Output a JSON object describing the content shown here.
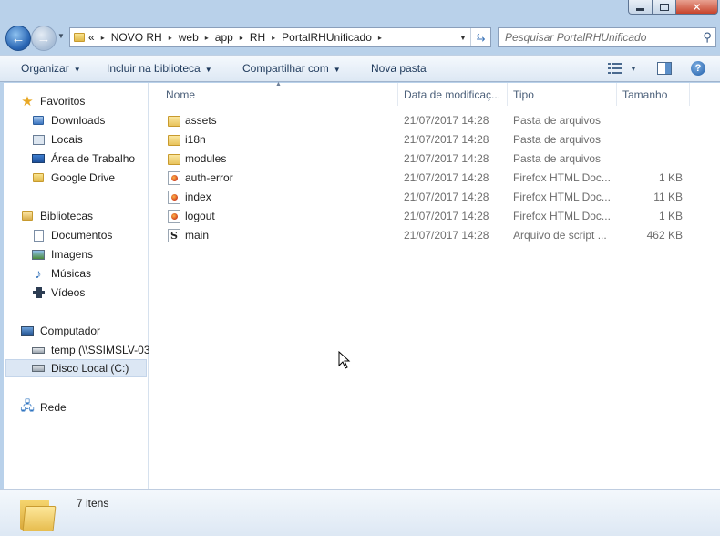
{
  "address_bar": {
    "overflow": "«",
    "crumbs": [
      "NOVO RH",
      "web",
      "app",
      "RH",
      "PortalRHUnificado"
    ]
  },
  "search": {
    "placeholder": "Pesquisar PortalRHUnificado"
  },
  "toolbar": {
    "organize": "Organizar",
    "include_library": "Incluir na biblioteca",
    "share": "Compartilhar com",
    "new_folder": "Nova pasta"
  },
  "nav": {
    "favorites": {
      "label": "Favoritos",
      "items": [
        "Downloads",
        "Locais",
        "Área de Trabalho",
        "Google Drive"
      ]
    },
    "libraries": {
      "label": "Bibliotecas",
      "items": [
        "Documentos",
        "Imagens",
        "Músicas",
        "Vídeos"
      ]
    },
    "computer": {
      "label": "Computador",
      "items": [
        "temp (\\\\SSIMSLV-03",
        "Disco Local (C:)"
      ]
    },
    "network": {
      "label": "Rede"
    }
  },
  "columns": {
    "name": "Nome",
    "date": "Data de modificaç...",
    "type": "Tipo",
    "size": "Tamanho"
  },
  "files": [
    {
      "name": "assets",
      "date": "21/07/2017 14:28",
      "type": "Pasta de arquivos",
      "size": "",
      "icon": "folder-icon"
    },
    {
      "name": "i18n",
      "date": "21/07/2017 14:28",
      "type": "Pasta de arquivos",
      "size": "",
      "icon": "folder-icon"
    },
    {
      "name": "modules",
      "date": "21/07/2017 14:28",
      "type": "Pasta de arquivos",
      "size": "",
      "icon": "folder-icon"
    },
    {
      "name": "auth-error",
      "date": "21/07/2017 14:28",
      "type": "Firefox HTML Doc...",
      "size": "1 KB",
      "icon": "html-file-icon"
    },
    {
      "name": "index",
      "date": "21/07/2017 14:28",
      "type": "Firefox HTML Doc...",
      "size": "11 KB",
      "icon": "html-file-icon"
    },
    {
      "name": "logout",
      "date": "21/07/2017 14:28",
      "type": "Firefox HTML Doc...",
      "size": "1 KB",
      "icon": "html-file-icon"
    },
    {
      "name": "main",
      "date": "21/07/2017 14:28",
      "type": "Arquivo de script ...",
      "size": "462 KB",
      "icon": "script-file-icon"
    }
  ],
  "details": {
    "count": "7 itens"
  }
}
